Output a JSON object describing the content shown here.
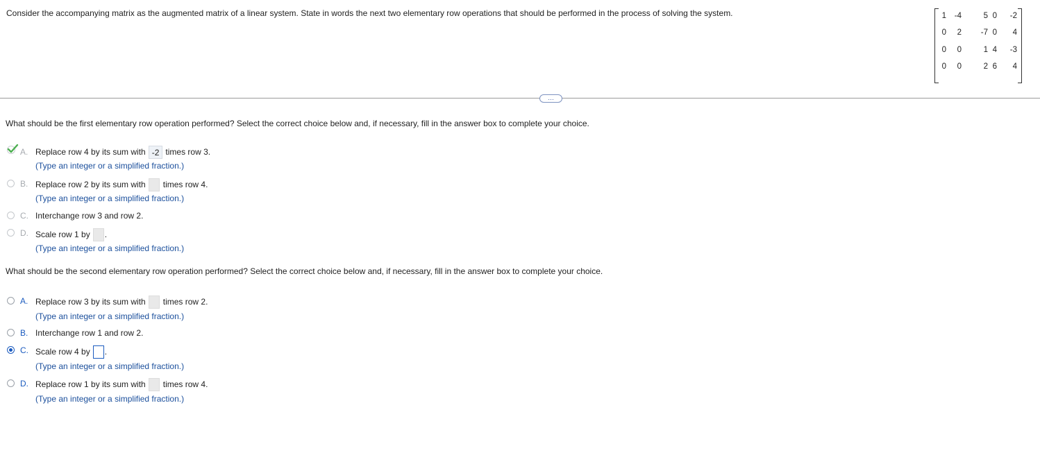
{
  "prompt": "Consider the accompanying matrix as the augmented matrix of a linear system. State in words the next two elementary row operations that should be performed in the process of solving the system.",
  "matrix": [
    [
      "1",
      "-4",
      "5",
      "0",
      "-2"
    ],
    [
      "0",
      "2",
      "-7",
      "0",
      "4"
    ],
    [
      "0",
      "0",
      "1",
      "4",
      "-3"
    ],
    [
      "0",
      "0",
      "2",
      "6",
      "4"
    ]
  ],
  "more_button": "…",
  "q1": {
    "question": "What should be the first elementary row operation performed? Select the correct choice below and, if necessary, fill in the answer box to complete your choice.",
    "options": [
      {
        "letter": "A.",
        "pre": "Replace row 4 by its sum with",
        "value": "-2",
        "post": "times row 3.",
        "hint": "(Type an integer or a simplified fraction.)",
        "state": "correct"
      },
      {
        "letter": "B.",
        "pre": "Replace row 2 by its sum with",
        "value": "",
        "post": "times row 4.",
        "hint": "(Type an integer or a simplified fraction.)",
        "state": "disabled"
      },
      {
        "letter": "C.",
        "pre": "Interchange row 3 and row 2.",
        "state": "disabled"
      },
      {
        "letter": "D.",
        "pre": "Scale row 1 by",
        "value": "",
        "post": ".",
        "hint": "(Type an integer or a simplified fraction.)",
        "state": "disabled"
      }
    ]
  },
  "q2": {
    "question": "What should be the second elementary row operation performed? Select the correct choice below and, if necessary, fill in the answer box to complete your choice.",
    "options": [
      {
        "letter": "A.",
        "pre": "Replace row 3 by its sum with",
        "value": "",
        "post": "times row 2.",
        "hint": "(Type an integer or a simplified fraction.)",
        "state": "unselected"
      },
      {
        "letter": "B.",
        "pre": "Interchange row 1 and row 2.",
        "state": "unselected"
      },
      {
        "letter": "C.",
        "pre": "Scale row 4 by",
        "value": "",
        "post": ".",
        "hint": "(Type an integer or a simplified fraction.)",
        "state": "selected"
      },
      {
        "letter": "D.",
        "pre": "Replace row 1 by its sum with",
        "value": "",
        "post": "times row 4.",
        "hint": "(Type an integer or a simplified fraction.)",
        "state": "unselected"
      }
    ]
  },
  "colors": {
    "accent": "#1b5bbf",
    "correct": "#4caf50",
    "hint": "#1b4f9c"
  }
}
